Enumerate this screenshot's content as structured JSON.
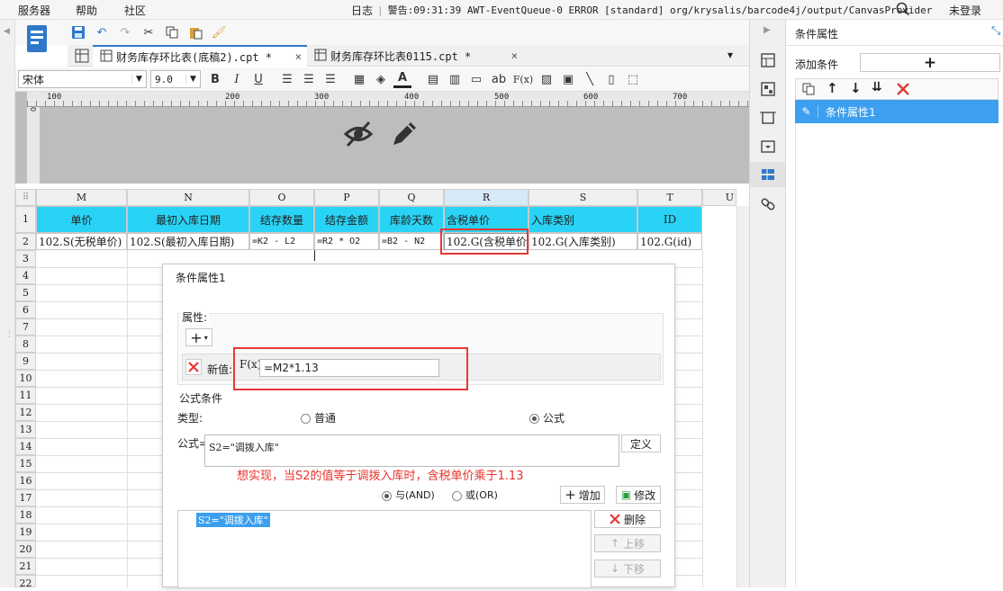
{
  "menubar": {
    "items": [
      "服务器",
      "帮助",
      "社区"
    ],
    "log_label": "日志",
    "warning_text": "警告:09:31:39 AWT-EventQueue-0 ERROR [standard] org/krysalis/barcode4j/output/CanvasProvider",
    "login_label": "未登录"
  },
  "tabs": [
    {
      "label": "财务库存环比表(底稿2).cpt *"
    },
    {
      "label": "财务库存环比表0115.cpt *"
    }
  ],
  "format_toolbar": {
    "font_name": "宋体",
    "font_size": "9.0",
    "bold": "B",
    "italic": "I",
    "underline": "U",
    "text_tool": "ab",
    "formula_tool": "F(x)"
  },
  "ruler": {
    "ticks": [
      "100",
      "200",
      "300",
      "400",
      "500",
      "600",
      "700"
    ],
    "vertical_zero": "0"
  },
  "grid": {
    "columns": [
      "M",
      "N",
      "O",
      "P",
      "Q",
      "R",
      "S",
      "T",
      "U"
    ],
    "row_numbers": [
      "1",
      "2",
      "3",
      "4",
      "5",
      "6",
      "7",
      "8",
      "9",
      "10",
      "11",
      "12",
      "13",
      "14",
      "15",
      "16",
      "17",
      "18",
      "19",
      "20",
      "21",
      "22"
    ],
    "header_row": [
      "单价",
      "最初入库日期",
      "结存数量",
      "结存金额",
      "库龄天数",
      "含税单价",
      "入库类别",
      "ID"
    ],
    "data_row": [
      "102.S(无税单价)",
      "102.S(最初入库日期)",
      "=K2 - L2",
      "=R2 * O2",
      "=B2 - N2",
      "102.G(含税单价)",
      "102.G(入库类别)",
      "102.G(id)"
    ]
  },
  "dialog": {
    "title": "条件属性1",
    "property_section": "属性:",
    "new_value_label": "新值:",
    "new_value": "=M2*1.13",
    "fx_label": "F(x)",
    "formula_section": "公式条件",
    "type_label": "类型:",
    "type_normal": "普通",
    "type_formula": "公式",
    "formula_label": "公式=",
    "formula_value": "S2=\"调拨入库\"",
    "define_button": "定义",
    "annotation": "想实现，当S2的值等于调拨入库时，含税单价乘于1.13",
    "and_label": "与(AND)",
    "or_label": "或(OR)",
    "add_button": "增加",
    "modify_button": "修改",
    "condition_item": "S2=\"调拨入库\"",
    "delete_button": "删除",
    "move_up_button": "上移",
    "move_down_button": "下移"
  },
  "right_panel": {
    "title": "条件属性",
    "add_condition_label": "添加条件",
    "add_button": "+",
    "list_item": "条件属性1"
  },
  "colors": {
    "header_cell": "#29d3f5",
    "highlight_red": "#e53935",
    "selected_blue": "#3c9fef",
    "annotation_red": "#e8332c"
  }
}
